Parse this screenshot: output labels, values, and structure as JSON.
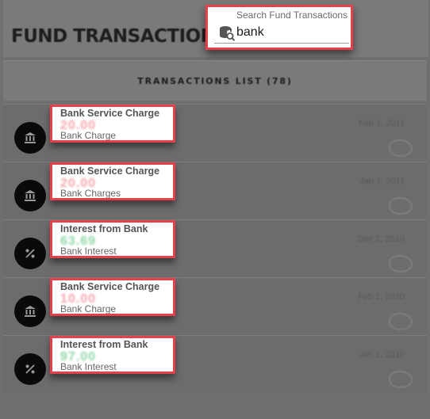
{
  "header": {
    "title": "FUND TRANSACTIONS"
  },
  "search": {
    "label": "Search Fund Transactions",
    "value": "bank",
    "icon": "database-search-icon"
  },
  "list": {
    "title": "TRANSACTIONS LIST (78)"
  },
  "colors": {
    "highlight_border": "#e8404a",
    "debit": "#f4a5ad",
    "credit": "#8fd6a6"
  },
  "transactions": [
    {
      "title": "Bank Service Charge",
      "amount": "20.00",
      "type": "debit",
      "category": "Bank Charge",
      "date": "Feb 1, 2011",
      "icon": "bank-icon"
    },
    {
      "title": "Bank Service Charge",
      "amount": "20.00",
      "type": "debit",
      "category": "Bank Charges",
      "date": "Jan 1, 2011",
      "icon": "bank-icon"
    },
    {
      "title": "Interest from Bank",
      "amount": "63.69",
      "type": "credit",
      "category": "Bank Interest",
      "date": "Dec 1, 2010",
      "icon": "percent-icon"
    },
    {
      "title": "Bank Service Charge",
      "amount": "10.00",
      "type": "debit",
      "category": "Bank Charge",
      "date": "Feb 1, 2010",
      "icon": "bank-icon"
    },
    {
      "title": "Interest from Bank",
      "amount": "97.00",
      "type": "credit",
      "category": "Bank Interest",
      "date": "Jan 1, 2010",
      "icon": "percent-icon"
    }
  ]
}
